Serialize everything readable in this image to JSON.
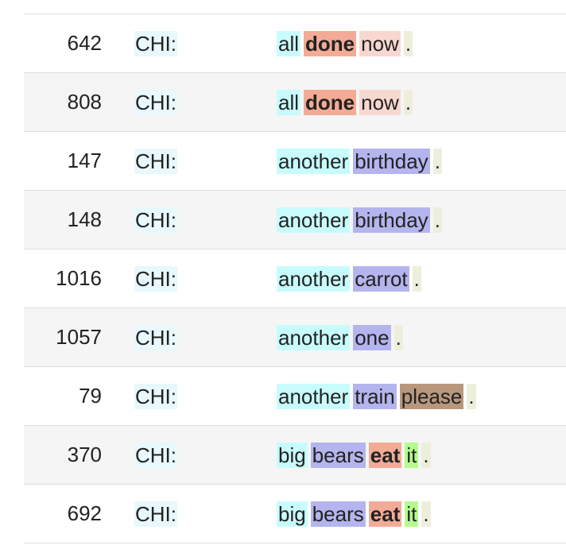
{
  "colors": {
    "row_alt_bg": "#f5f5f5",
    "row_border": "#dddddd",
    "speaker_bg": "#e8f8fd",
    "det": "#c8fcfc",
    "verb": "#f4ab95",
    "adv": "#f7d8d0",
    "noun": "#b4b4ee",
    "punct": "#eeeedd",
    "interj": "#b8977d",
    "pron": "#b5fb8e"
  },
  "rows": [
    {
      "id": "642",
      "speaker": "CHI:",
      "tokens": [
        {
          "text": "all",
          "color": "#c8fcfc",
          "bold": false
        },
        {
          "text": "done",
          "color": "#f4ab95",
          "bold": true
        },
        {
          "text": "now",
          "color": "#f7d8d0",
          "bold": false
        },
        {
          "text": ".",
          "color": "#eeeedd",
          "bold": false
        }
      ]
    },
    {
      "id": "808",
      "speaker": "CHI:",
      "tokens": [
        {
          "text": "all",
          "color": "#c8fcfc",
          "bold": false
        },
        {
          "text": "done",
          "color": "#f4ab95",
          "bold": true
        },
        {
          "text": "now",
          "color": "#f7d8d0",
          "bold": false
        },
        {
          "text": ".",
          "color": "#eeeedd",
          "bold": false
        }
      ]
    },
    {
      "id": "147",
      "speaker": "CHI:",
      "tokens": [
        {
          "text": "another",
          "color": "#c8fcfc",
          "bold": false
        },
        {
          "text": "birthday",
          "color": "#b4b4ee",
          "bold": false
        },
        {
          "text": ".",
          "color": "#eeeedd",
          "bold": false
        }
      ]
    },
    {
      "id": "148",
      "speaker": "CHI:",
      "tokens": [
        {
          "text": "another",
          "color": "#c8fcfc",
          "bold": false
        },
        {
          "text": "birthday",
          "color": "#b4b4ee",
          "bold": false
        },
        {
          "text": ".",
          "color": "#eeeedd",
          "bold": false
        }
      ]
    },
    {
      "id": "1016",
      "speaker": "CHI:",
      "tokens": [
        {
          "text": "another",
          "color": "#c8fcfc",
          "bold": false
        },
        {
          "text": "carrot",
          "color": "#b4b4ee",
          "bold": false
        },
        {
          "text": ".",
          "color": "#eeeedd",
          "bold": false
        }
      ]
    },
    {
      "id": "1057",
      "speaker": "CHI:",
      "tokens": [
        {
          "text": "another",
          "color": "#c8fcfc",
          "bold": false
        },
        {
          "text": "one",
          "color": "#b4b4ee",
          "bold": false
        },
        {
          "text": ".",
          "color": "#eeeedd",
          "bold": false
        }
      ]
    },
    {
      "id": "79",
      "speaker": "CHI:",
      "tokens": [
        {
          "text": "another",
          "color": "#c8fcfc",
          "bold": false
        },
        {
          "text": "train",
          "color": "#b4b4ee",
          "bold": false
        },
        {
          "text": "please",
          "color": "#b8977d",
          "bold": false
        },
        {
          "text": ".",
          "color": "#eeeedd",
          "bold": false
        }
      ]
    },
    {
      "id": "370",
      "speaker": "CHI:",
      "tokens": [
        {
          "text": "big",
          "color": "#c8fcfc",
          "bold": false
        },
        {
          "text": "bears",
          "color": "#b4b4ee",
          "bold": false
        },
        {
          "text": "eat",
          "color": "#f4ab95",
          "bold": true
        },
        {
          "text": "it",
          "color": "#b5fb8e",
          "bold": false
        },
        {
          "text": ".",
          "color": "#eeeedd",
          "bold": false
        }
      ]
    },
    {
      "id": "692",
      "speaker": "CHI:",
      "tokens": [
        {
          "text": "big",
          "color": "#c8fcfc",
          "bold": false
        },
        {
          "text": "bears",
          "color": "#b4b4ee",
          "bold": false
        },
        {
          "text": "eat",
          "color": "#f4ab95",
          "bold": true
        },
        {
          "text": "it",
          "color": "#b5fb8e",
          "bold": false
        },
        {
          "text": ".",
          "color": "#eeeedd",
          "bold": false
        }
      ]
    }
  ]
}
